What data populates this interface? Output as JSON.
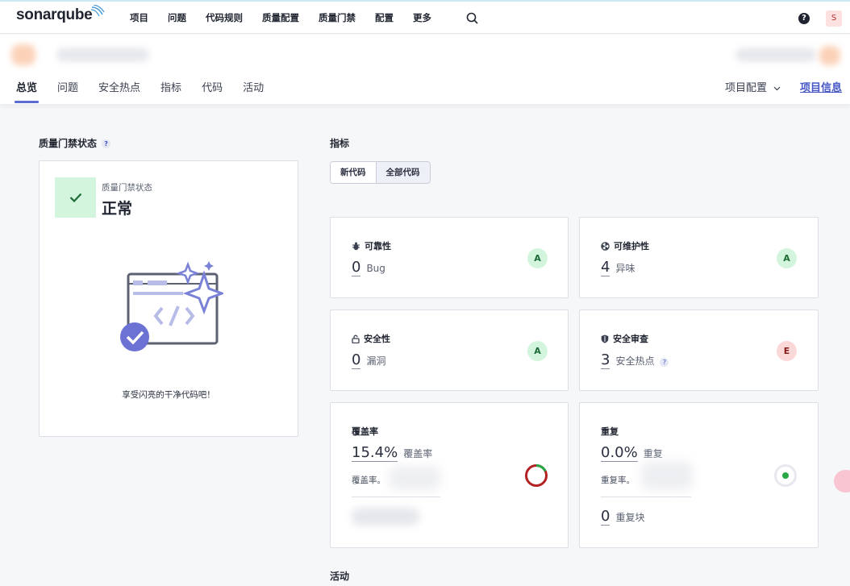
{
  "brand": {
    "name": "sonarqube"
  },
  "topnav": {
    "items": [
      "项目",
      "问题",
      "代码规则",
      "质量配置",
      "质量门禁",
      "配置",
      "更多"
    ],
    "help": "?",
    "avatar": "S"
  },
  "project": {
    "tabs": [
      "总览",
      "问题",
      "安全热点",
      "指标",
      "代码",
      "活动"
    ],
    "settings": "项目配置",
    "info": "项目信息"
  },
  "quality_gate": {
    "section_title": "质量门禁状态",
    "label": "质量门禁状态",
    "status": "正常",
    "message": "享受闪亮的干净代码吧！"
  },
  "metrics": {
    "section_title": "指标",
    "toggle": {
      "new_code": "新代码",
      "overall_code": "全部代码"
    },
    "reliability": {
      "title": "可靠性",
      "value": "0",
      "unit": "Bug",
      "grade": "A"
    },
    "maintainability": {
      "title": "可维护性",
      "value": "4",
      "unit": "异味",
      "grade": "A"
    },
    "security": {
      "title": "安全性",
      "value": "0",
      "unit": "漏洞",
      "grade": "A"
    },
    "security_review": {
      "title": "安全审查",
      "value": "3",
      "unit": "安全热点",
      "grade": "E"
    },
    "coverage": {
      "title": "覆盖率",
      "value": "15.4%",
      "unit": "覆盖率",
      "subtext": "覆盖率。"
    },
    "duplication": {
      "title": "重复",
      "value": "0.0%",
      "unit": "重复",
      "subtext": "重复率。",
      "blocks_value": "0",
      "blocks_unit": "重复块"
    }
  },
  "activity": {
    "section_title": "活动"
  },
  "colors": {
    "accent": "#5d6cd0",
    "link": "#4656c5",
    "pass": "#d3f5dd",
    "fail": "#fbd8d8",
    "coverage_ring": "#b22222",
    "dup_dot": "#27a745"
  }
}
